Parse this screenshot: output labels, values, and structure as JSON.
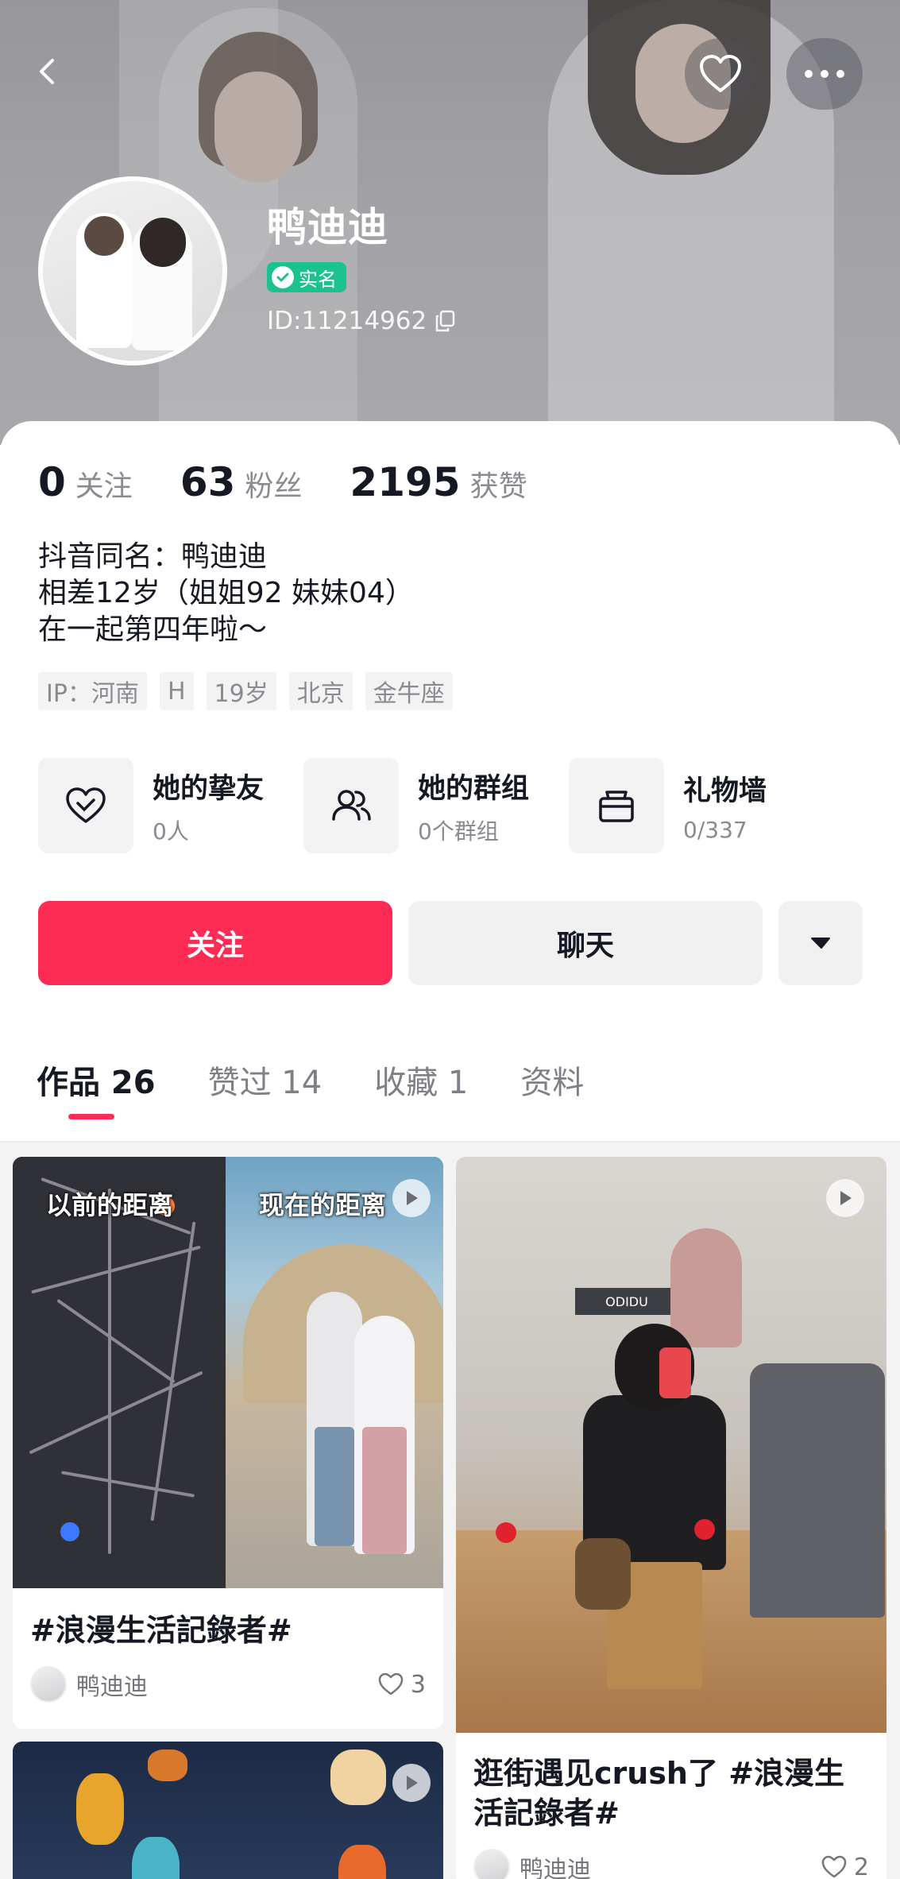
{
  "profile": {
    "name": "鸭迪迪",
    "verified_label": "实名",
    "user_id": "ID:11214962"
  },
  "stats": [
    {
      "num": "0",
      "label": "关注"
    },
    {
      "num": "63",
      "label": "粉丝"
    },
    {
      "num": "2195",
      "label": "获赞"
    }
  ],
  "bio": [
    "抖音同名：鸭迪迪",
    "相差12岁（姐姐92 妹妹04）",
    "在一起第四年啦～"
  ],
  "tags": [
    "IP：河南",
    "H",
    "19岁",
    "北京",
    "金牛座"
  ],
  "features": [
    {
      "icon": "heart-outline-icon",
      "title": "她的挚友",
      "sub": "0人"
    },
    {
      "icon": "group-icon",
      "title": "她的群组",
      "sub": "0个群组"
    },
    {
      "icon": "gift-icon",
      "title": "礼物墙",
      "sub": "0/337"
    }
  ],
  "actions": {
    "follow": "关注",
    "chat": "聊天"
  },
  "tabs": [
    {
      "label": "作品 26",
      "active": true
    },
    {
      "label": "赞过 14",
      "active": false
    },
    {
      "label": "收藏 1",
      "active": false
    },
    {
      "label": "资料",
      "active": false
    }
  ],
  "posts": [
    {
      "overlay_left": "以前的距离",
      "overlay_right": "现在的距离",
      "title": "#浪漫生活記錄者#",
      "author": "鸭迪迪",
      "likes": "3"
    },
    {
      "store_sign": "ODIDU",
      "title_line1": "逛街遇见crush了 #浪漫生",
      "title_line2": "活記錄者#",
      "author": "鸭迪迪",
      "likes": "2"
    }
  ],
  "colors": {
    "accent": "#fe2c55",
    "verified": "#19c28e",
    "muted_text": "#8a8b91"
  }
}
